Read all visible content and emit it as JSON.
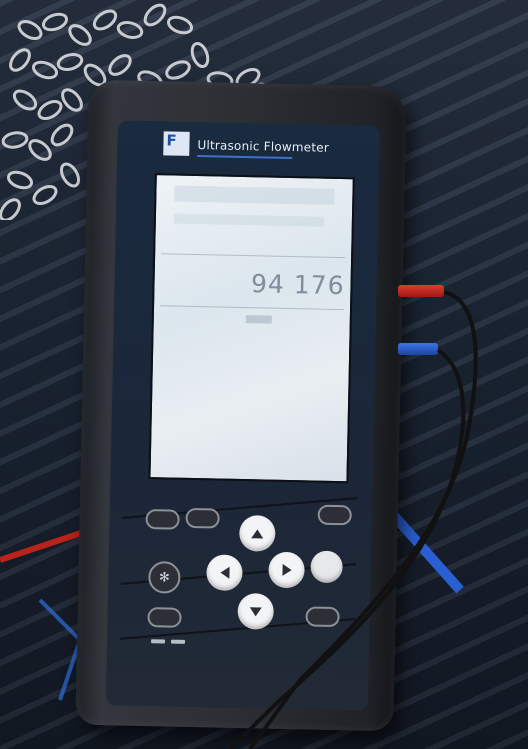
{
  "device": {
    "logo_letter": "F",
    "title": "Ultrasonic Flowmeter",
    "display_reading": "94 176",
    "colors": {
      "body": "#2b2e33",
      "face": "#1b2638",
      "accent": "#3d72c8",
      "screen": "#e3eaf0",
      "lead_red": "#c8261e",
      "lead_blue": "#2a5fd1"
    }
  },
  "keys": {
    "top_left_1": "",
    "top_left_2": "",
    "esc": "",
    "snowflake_key": "",
    "ent": "",
    "menu": "",
    "bottom_right": ""
  },
  "icons": [
    "up-arrow-icon",
    "down-arrow-icon",
    "left-arrow-icon",
    "right-arrow-icon",
    "snowflake-icon",
    "logo-icon"
  ]
}
